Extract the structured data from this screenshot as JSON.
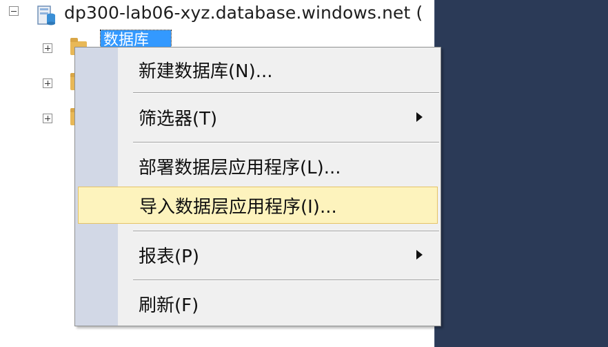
{
  "object_explorer": {
    "server_label": "dp300-lab06-xyz.database.windows.net (",
    "selected_node_label": "数据库"
  },
  "context_menu": {
    "items": [
      {
        "label": "新建数据库(N)...",
        "has_submenu": false
      },
      {
        "label": "筛选器(T)",
        "has_submenu": true
      },
      {
        "label": "部署数据层应用程序(L)...",
        "has_submenu": false
      },
      {
        "label": "导入数据层应用程序(I)...",
        "has_submenu": false,
        "highlighted": true
      },
      {
        "label": "报表(P)",
        "has_submenu": true
      },
      {
        "label": "刷新(F)",
        "has_submenu": false
      }
    ]
  },
  "colors": {
    "right_panel": "#2b3a57",
    "highlight": "#fdf3bd",
    "selection": "#3399ff"
  }
}
